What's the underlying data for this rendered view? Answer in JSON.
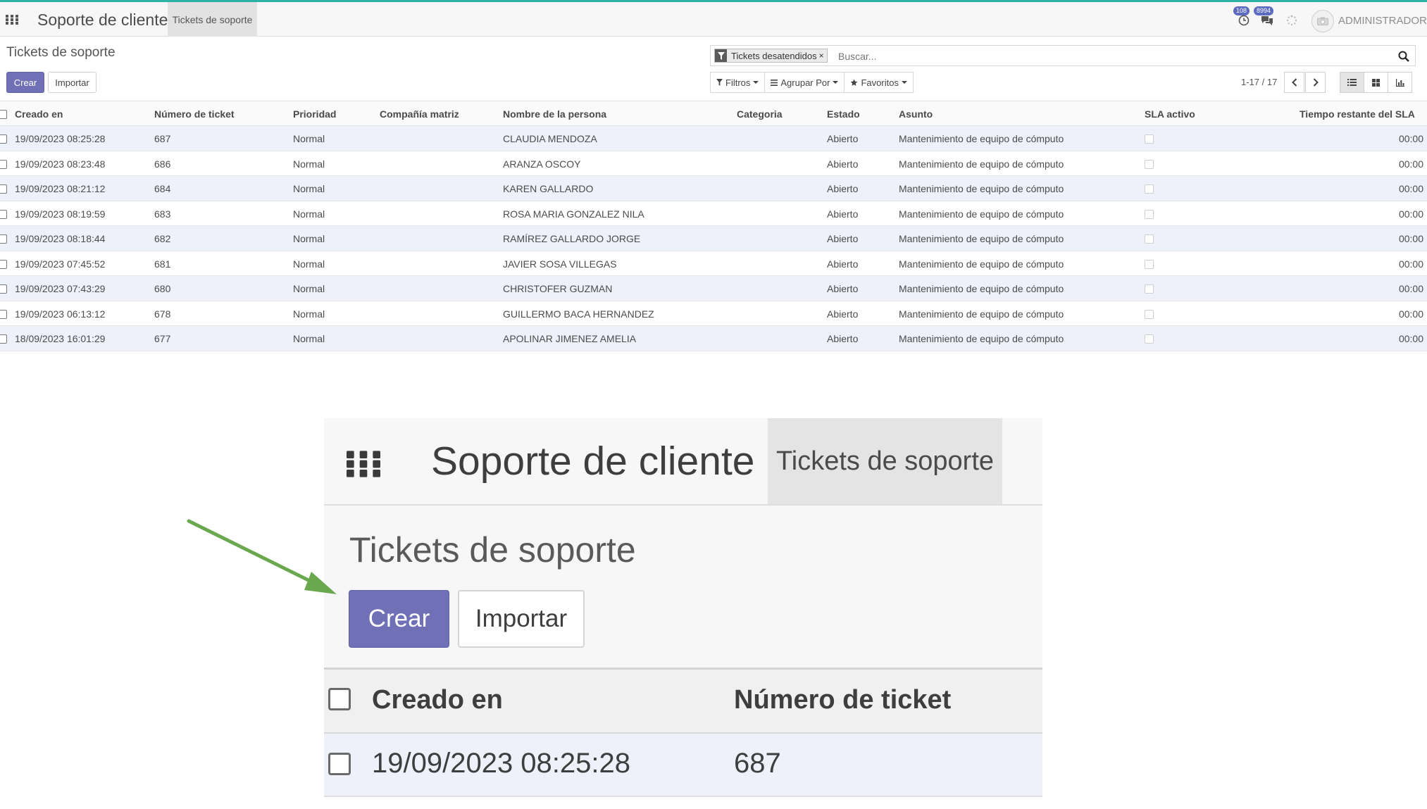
{
  "navbar": {
    "app_name": "Soporte de cliente",
    "menu_tab": "Tickets de soporte",
    "activity_badge": "108",
    "messages_badge": "8994",
    "user_name": "ADMINISTRADOR",
    "icons": [
      "apps-grid-icon",
      "clock-icon",
      "chat-icon",
      "spinner-icon",
      "camera-icon"
    ]
  },
  "control_panel": {
    "breadcrumb": "Tickets de soporte",
    "create_label": "Crear",
    "import_label": "Importar",
    "facet_label": "Tickets desatendidos",
    "facet_remove": "×",
    "search_placeholder": "Buscar...",
    "filters_label": "Filtros",
    "group_by_label": "Agrupar Por",
    "favorites_label": "Favoritos",
    "pager": "1-17 / 17"
  },
  "table": {
    "headers": {
      "created": "Creado en",
      "number": "Número de ticket",
      "priority": "Prioridad",
      "company": "Compañía matriz",
      "person": "Nombre de la persona",
      "category": "Categoria",
      "state": "Estado",
      "subject": "Asunto",
      "sla": "SLA activo",
      "remaining": "Tiempo restante del SLA"
    },
    "rows": [
      {
        "created": "19/09/2023 08:25:28",
        "number": "687",
        "priority": "Normal",
        "person": "CLAUDIA MENDOZA",
        "state": "Abierto",
        "subject": "Mantenimiento de equipo de cómputo",
        "remaining": "00:00"
      },
      {
        "created": "19/09/2023 08:23:48",
        "number": "686",
        "priority": "Normal",
        "person": "ARANZA OSCOY",
        "state": "Abierto",
        "subject": "Mantenimiento de equipo de cómputo",
        "remaining": "00:00"
      },
      {
        "created": "19/09/2023 08:21:12",
        "number": "684",
        "priority": "Normal",
        "person": "KAREN GALLARDO",
        "state": "Abierto",
        "subject": "Mantenimiento de equipo de cómputo",
        "remaining": "00:00"
      },
      {
        "created": "19/09/2023 08:19:59",
        "number": "683",
        "priority": "Normal",
        "person": "ROSA MARIA GONZALEZ NILA",
        "state": "Abierto",
        "subject": "Mantenimiento de equipo de cómputo",
        "remaining": "00:00"
      },
      {
        "created": "19/09/2023 08:18:44",
        "number": "682",
        "priority": "Normal",
        "person": "RAMÍREZ GALLARDO JORGE",
        "state": "Abierto",
        "subject": "Mantenimiento de equipo de cómputo",
        "remaining": "00:00"
      },
      {
        "created": "19/09/2023 07:45:52",
        "number": "681",
        "priority": "Normal",
        "person": "JAVIER SOSA VILLEGAS",
        "state": "Abierto",
        "subject": "Mantenimiento de equipo de cómputo",
        "remaining": "00:00"
      },
      {
        "created": "19/09/2023 07:43:29",
        "number": "680",
        "priority": "Normal",
        "person": "CHRISTOFER GUZMAN",
        "state": "Abierto",
        "subject": "Mantenimiento de equipo de cómputo",
        "remaining": "00:00"
      },
      {
        "created": "19/09/2023 06:13:12",
        "number": "678",
        "priority": "Normal",
        "person": "GUILLERMO BACA HERNANDEZ",
        "state": "Abierto",
        "subject": "Mantenimiento de equipo de cómputo",
        "remaining": "00:00"
      },
      {
        "created": "18/09/2023 16:01:29",
        "number": "677",
        "priority": "Normal",
        "person": "APOLINAR JIMENEZ AMELIA",
        "state": "Abierto",
        "subject": "Mantenimiento de equipo de cómputo",
        "remaining": "00:00"
      }
    ]
  },
  "zoom": {
    "app_name": "Soporte de cliente",
    "menu_tab": "Tickets de soporte",
    "title": "Tickets de soporte",
    "create_label": "Crear",
    "import_label": "Importar",
    "header_created": "Creado en",
    "header_number": "Número de ticket",
    "row_created": "19/09/2023 08:25:28",
    "row_number": "687"
  },
  "colors": {
    "accent_top": "#2bb3a9",
    "primary_button": "#6f70b5",
    "annotation_arrow": "#6aa84f",
    "row_stripe": "#eef0fa"
  }
}
